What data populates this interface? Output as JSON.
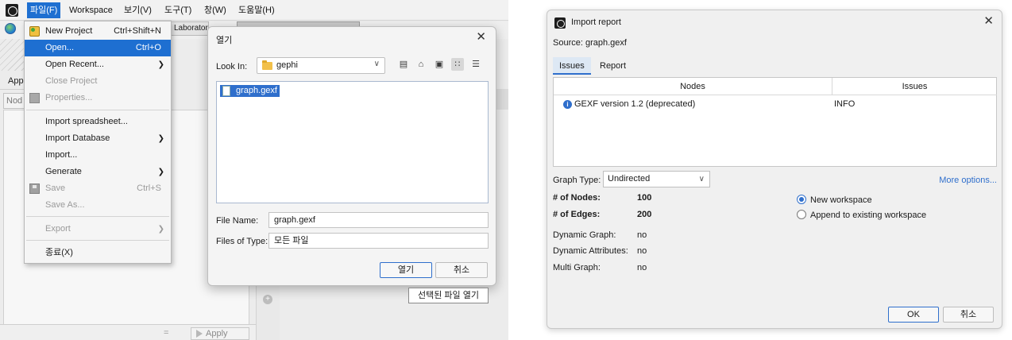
{
  "main_window": {
    "menubar": [
      "파일(F)",
      "Workspace",
      "보기(V)",
      "도구(T)",
      "창(W)",
      "도움말(H)"
    ],
    "lab_tab": "Laborator",
    "app_label": "App",
    "nod_tab": "Nod",
    "apply_label": "Apply",
    "bottom_eq": "="
  },
  "file_menu": {
    "new_project": "New Project",
    "new_project_sc": "Ctrl+Shift+N",
    "open": "Open...",
    "open_sc": "Ctrl+O",
    "open_recent": "Open Recent...",
    "close_project": "Close Project",
    "properties": "Properties...",
    "import_spreadsheet": "Import spreadsheet...",
    "import_database": "Import Database",
    "import": "Import...",
    "generate": "Generate",
    "save": "Save",
    "save_sc": "Ctrl+S",
    "save_as": "Save As...",
    "export": "Export",
    "exit": "종료(X)"
  },
  "open_dialog": {
    "title": "열기",
    "look_in_label": "Look In:",
    "look_in_value": "gephi",
    "files": [
      "graph.gexf"
    ],
    "file_name_label": "File Name:",
    "file_name_value": "graph.gexf",
    "files_of_type_label": "Files of Type:",
    "files_of_type_value": "모든 파일",
    "open_button": "열기",
    "cancel_button": "취소",
    "tooltip": "선택된 파일 열기"
  },
  "import_report": {
    "title": "Import report",
    "source": "Source:  graph.gexf",
    "tabs": [
      "Issues",
      "Report"
    ],
    "table_headers": [
      "Nodes",
      "Issues"
    ],
    "rows": [
      {
        "message": "GEXF version 1.2 (deprecated)",
        "level": "INFO"
      }
    ],
    "graph_type_label": "Graph Type:",
    "graph_type_value": "Undirected",
    "more_options": "More options...",
    "nodes_label": "# of Nodes:",
    "nodes_value": "100",
    "edges_label": "# of Edges:",
    "edges_value": "200",
    "dynamic_graph_label": "Dynamic Graph:",
    "dynamic_graph_value": "no",
    "dynamic_attr_label": "Dynamic Attributes:",
    "dynamic_attr_value": "no",
    "multi_graph_label": "Multi Graph:",
    "multi_graph_value": "no",
    "radio_new": "New workspace",
    "radio_append": "Append to existing workspace",
    "ok_button": "OK",
    "cancel_button": "취소"
  }
}
